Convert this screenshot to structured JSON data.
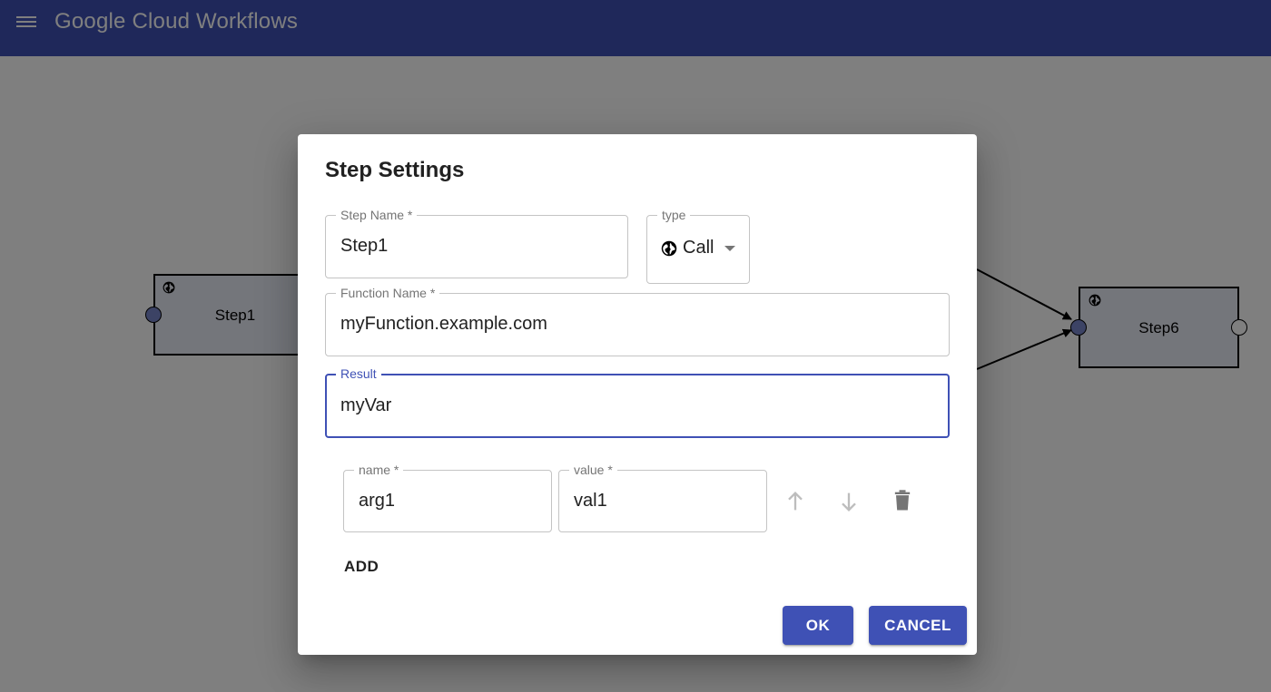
{
  "app": {
    "title": "Google Cloud Workflows"
  },
  "canvas": {
    "nodes": [
      {
        "id": "step1",
        "label": "Step1",
        "icon": "globe-icon"
      },
      {
        "id": "step6",
        "label": "Step6",
        "icon": "globe-icon"
      }
    ]
  },
  "dialog": {
    "title": "Step Settings",
    "step_name": {
      "label": "Step Name *",
      "value": "Step1"
    },
    "type": {
      "label": "type",
      "value": "Call",
      "icon": "globe-icon"
    },
    "function_name": {
      "label": "Function Name *",
      "value": "myFunction.example.com"
    },
    "result": {
      "label": "Result",
      "value": "myVar"
    },
    "args": [
      {
        "name_label": "name *",
        "name_value": "arg1",
        "value_label": "value *",
        "value_value": "val1"
      }
    ],
    "add_label": "ADD",
    "ok_label": "OK",
    "cancel_label": "CANCEL"
  },
  "colors": {
    "appbar": "#3f51b5",
    "primary": "#3f51b5",
    "node_fill": "#e9ecf7",
    "port_in": "#7986cb"
  }
}
